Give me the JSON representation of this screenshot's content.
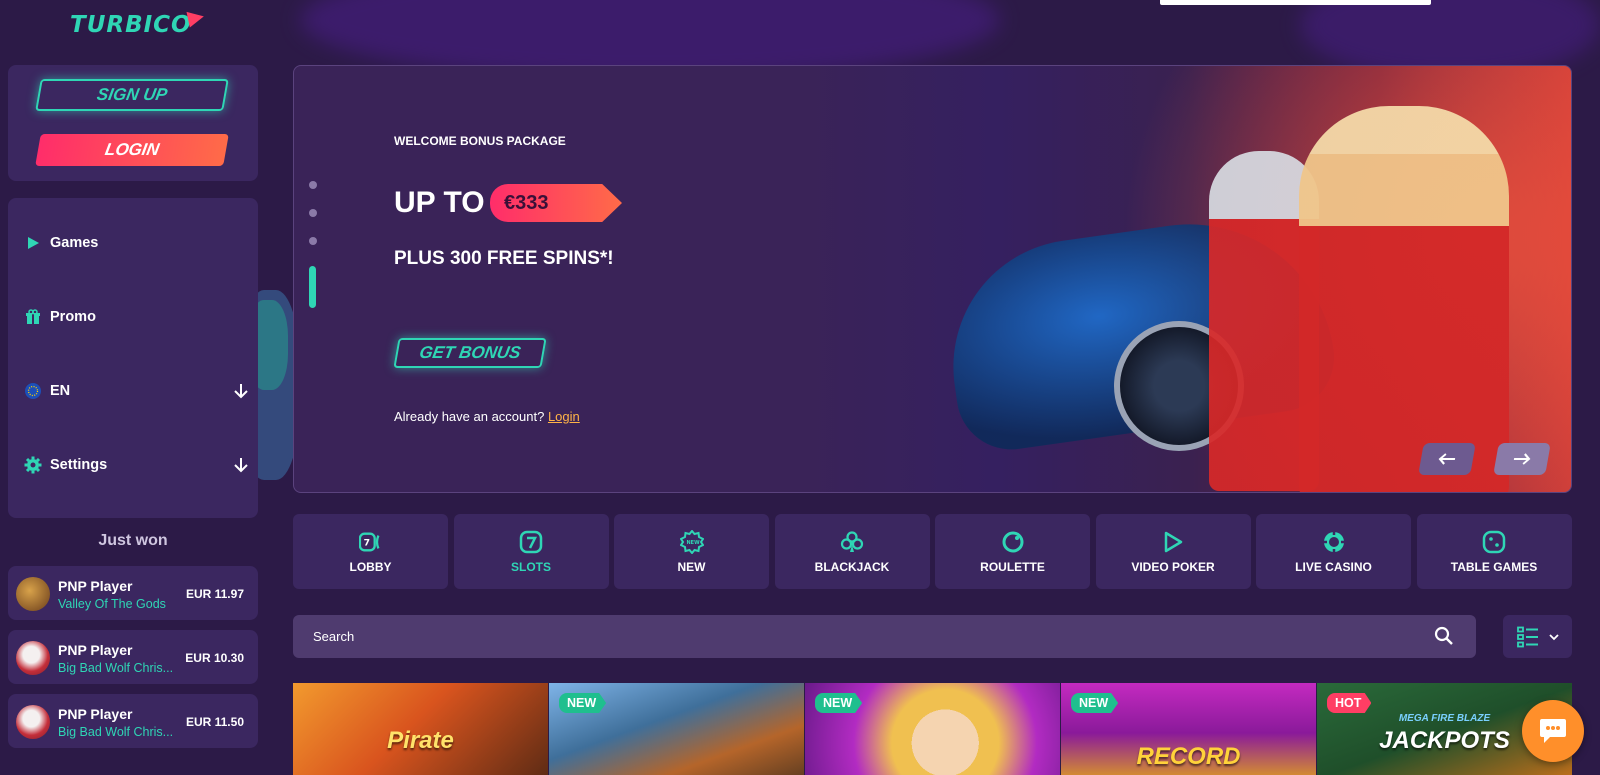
{
  "brand": {
    "logo_text": "TURBICO"
  },
  "auth": {
    "signup_label": "SIGN UP",
    "login_label": "LOGIN"
  },
  "sidebar": {
    "items": [
      {
        "label": "Games",
        "icon": "play-icon"
      },
      {
        "label": "Promo",
        "icon": "gift-icon"
      },
      {
        "label": "EN",
        "icon": "eu-flag-icon",
        "has_dropdown": true
      },
      {
        "label": "Settings",
        "icon": "gear-icon",
        "has_dropdown": true
      }
    ]
  },
  "just_won": {
    "title": "Just won",
    "rows": [
      {
        "player": "PNP Player",
        "game": "Valley Of The Gods",
        "amount": "EUR 11.97"
      },
      {
        "player": "PNP Player",
        "game": "Big Bad Wolf Chris...",
        "amount": "EUR 10.30"
      },
      {
        "player": "PNP Player",
        "game": "Big Bad Wolf Chris...",
        "amount": "EUR 11.50"
      }
    ]
  },
  "hero": {
    "kicker": "WELCOME BONUS PACKAGE",
    "up_to": "UP TO",
    "amount": "€333",
    "spins": "PLUS 300 FREE SPINS*!",
    "cta": "GET BONUS",
    "account_text": "Already have an account?",
    "login_link": "Login",
    "slides_total": 4,
    "slide_active": 4
  },
  "categories": [
    {
      "label": "LOBBY",
      "icon": "lobby-icon",
      "active": false
    },
    {
      "label": "SLOTS",
      "icon": "slots-icon",
      "active": true
    },
    {
      "label": "NEW",
      "icon": "new-icon",
      "active": false
    },
    {
      "label": "BLACKJACK",
      "icon": "club-icon",
      "active": false
    },
    {
      "label": "ROULETTE",
      "icon": "roulette-icon",
      "active": false
    },
    {
      "label": "VIDEO POKER",
      "icon": "play-icon",
      "active": false
    },
    {
      "label": "LIVE CASINO",
      "icon": "chip-icon",
      "active": false
    },
    {
      "label": "TABLE GAMES",
      "icon": "dice-icon",
      "active": false
    }
  ],
  "search": {
    "placeholder": "Search"
  },
  "games": [
    {
      "badge": "",
      "title": "Pirate"
    },
    {
      "badge": "NEW",
      "title": ""
    },
    {
      "badge": "NEW",
      "title": ""
    },
    {
      "badge": "NEW",
      "title": "RECORD"
    },
    {
      "badge": "HOT",
      "title": "JACKPOTS",
      "subtitle": "MEGA FIRE BLAZE"
    }
  ],
  "colors": {
    "accent": "#2fd6b5",
    "primary": "#ff2d6a",
    "bg": "#2c1a47",
    "panel": "#3b2760"
  }
}
